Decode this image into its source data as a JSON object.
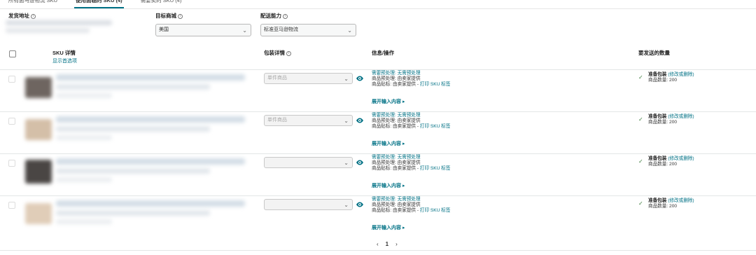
{
  "tabs": [
    {
      "label": "所有面马逊物流 SKU"
    },
    {
      "label": "便用面临的 SKU (4)"
    },
    {
      "label": "需要卖的 SKU (4)"
    }
  ],
  "filters": {
    "ship_from_label": "发货地址",
    "marketplace_label": "目标商城",
    "marketplace_value": "美国",
    "fulfillment_label": "配送能力",
    "fulfillment_value": "标准亚马逊物流"
  },
  "header": {
    "sku_details": "SKU 详情",
    "show_options": "显示首选项",
    "packing_details": "包装详情",
    "info_actions": "信息/操作",
    "quantity_to_send": "要发送的数量"
  },
  "rows": [
    {
      "package_value": "单件商品",
      "prep_label": "需要预处理:",
      "prep_value": "无需预处理",
      "prep_by": "商品预处理: 由卖家提供",
      "labeling_prefix": "商品贴标: 由卖家提供 -",
      "labeling_link": "打印 SKU 标签",
      "expand_label": "展开输入内容",
      "packing_status": "准备包装",
      "packing_action": "(修改或删除)",
      "quantity_label": "商品数量: 200"
    },
    {
      "package_value": "单件商品",
      "prep_label": "需要预处理:",
      "prep_value": "无需预处理",
      "prep_by": "商品预处理: 由卖家提供",
      "labeling_prefix": "商品贴标: 由卖家提供 -",
      "labeling_link": "打印 SKU 标签",
      "expand_label": "展开输入内容",
      "packing_status": "准备包装",
      "packing_action": "(修改或删除)",
      "quantity_label": "商品数量: 200"
    },
    {
      "package_value": "",
      "prep_label": "需要预处理:",
      "prep_value": "无需预处理",
      "prep_by": "商品预处理: 由卖家提供",
      "labeling_prefix": "商品贴标: 由卖家提供 -",
      "labeling_link": "打印 SKU 标签",
      "expand_label": "展开输入内容",
      "packing_status": "准备包装",
      "packing_action": "(修改或删除)",
      "quantity_label": "商品数量: 200"
    },
    {
      "package_value": "",
      "prep_label": "需要预处理:",
      "prep_value": "无需预处理",
      "prep_by": "商品预处理: 由卖家提供",
      "labeling_prefix": "商品贴标: 由卖家提供 -",
      "labeling_link": "打印 SKU 标签",
      "expand_label": "展开输入内容",
      "packing_status": "准备包装",
      "packing_action": "(修改或删除)",
      "quantity_label": "商品数量: 200"
    }
  ],
  "pagination": {
    "prev": "‹",
    "current": "1",
    "next": "›"
  },
  "icons": {
    "eye": "eye-icon",
    "check": "checkmark-icon",
    "chevron": "chevron-down-icon",
    "expand": "triangle-right-icon"
  },
  "colors": {
    "link": "#007185",
    "check": "#3a7a3a",
    "border": "#e3e6e6"
  }
}
